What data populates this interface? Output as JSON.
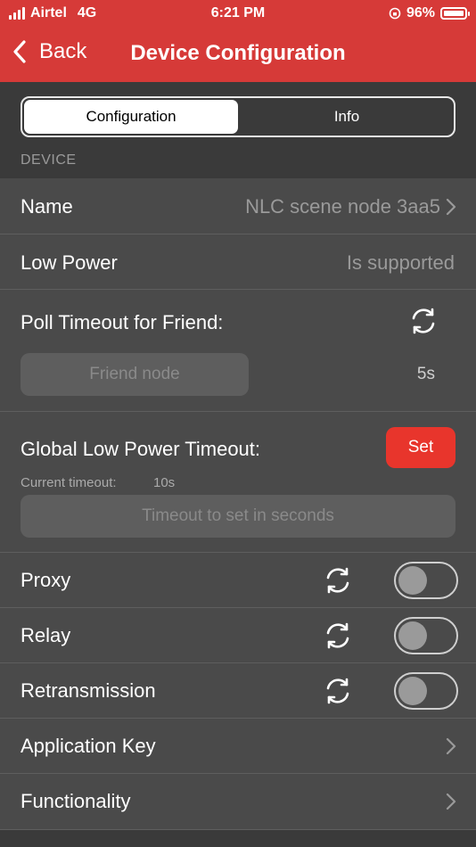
{
  "status": {
    "carrier": "Airtel",
    "network": "4G",
    "time": "6:21 PM",
    "battery": "96%"
  },
  "nav": {
    "back_label": "Back",
    "title": "Device Configuration"
  },
  "tabs": [
    {
      "label": "Configuration",
      "active": true
    },
    {
      "label": "Info",
      "active": false
    }
  ],
  "section_header": "DEVICE",
  "rows": {
    "name": {
      "label": "Name",
      "value": "NLC  scene node 3aa5"
    },
    "low_power": {
      "label": "Low Power",
      "value": "Is supported"
    },
    "poll_timeout": {
      "label": "Poll Timeout for Friend:",
      "button": "Friend node",
      "value": "5s"
    },
    "global_timeout": {
      "label": "Global Low Power Timeout:",
      "set_button": "Set",
      "current_label": "Current timeout:",
      "current_value": "10s",
      "placeholder": "Timeout to set in seconds"
    },
    "proxy": {
      "label": "Proxy",
      "enabled": false
    },
    "relay": {
      "label": "Relay",
      "enabled": false
    },
    "retransmission": {
      "label": "Retransmission",
      "enabled": false
    },
    "app_key": {
      "label": "Application Key"
    },
    "functionality": {
      "label": "Functionality"
    }
  },
  "colors": {
    "brand": "#d63a38",
    "accent": "#e8352c",
    "background": "#3a3a3a",
    "cell": "#4a4a4a"
  }
}
